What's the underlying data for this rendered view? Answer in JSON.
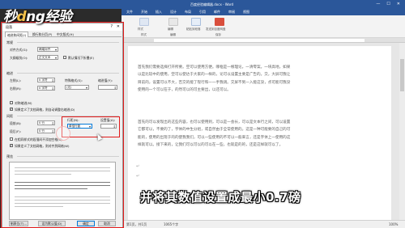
{
  "window": {
    "title": "百度经验编辑器.docx - Word",
    "controls": [
      "—",
      "☐",
      "✕"
    ]
  },
  "ribbon": {
    "tabs": [
      "文件",
      "开始",
      "插入",
      "设计",
      "布局",
      "引用",
      "邮件",
      "审阅",
      "视图"
    ],
    "buttons": [
      "样式",
      "编辑",
      "粘贴到段落",
      "发送到百度网盘"
    ],
    "groups": [
      "样式",
      "编辑",
      "保存"
    ]
  },
  "logo": {
    "text_before": "秒",
    "text_d": "d",
    "text_after": "ng经验"
  },
  "dialog": {
    "title": "段落",
    "help": "?",
    "close": "✕",
    "tabs": [
      "缩进和间距(I)",
      "换行和分页(P)",
      "中文版式(H)"
    ],
    "general": {
      "heading": "常规",
      "alignment_label": "对齐方式(G):",
      "alignment_value": "两端对齐",
      "outline_label": "大纲级别(O):",
      "outline_value": "正文文本",
      "collapse_label": "默认情况下折叠(E)"
    },
    "indent": {
      "heading": "缩进",
      "left_label": "左侧(L):",
      "left_value": "0 字符",
      "right_label": "右侧(R):",
      "right_value": "0 字符",
      "special_label": "特殊格式(S):",
      "special_value": "(无)",
      "indent_value_label": "缩进值(Y):",
      "mirror_label": "对称缩进(M)",
      "auto_adjust_label": "如果定义了文档网格，则自动调整右缩进(D)"
    },
    "spacing": {
      "heading": "间距",
      "before_label": "段前(B):",
      "before_value": "0 行",
      "after_label": "段后(F):",
      "after_value": "0 行",
      "line_spacing_label": "行距(N):",
      "line_spacing_value": "单倍行距",
      "setting_label": "设置值(A):",
      "no_space_label": "在相同样式的段落间不添加空格(C)",
      "snap_grid_label": "如果定义了文档网格，则对齐到网格(W)"
    },
    "preview": {
      "heading": "预览"
    },
    "buttons": {
      "tabs": "制表位(T)...",
      "default": "设为默认值(D)",
      "ok": "确定",
      "cancel": "取消"
    }
  },
  "document": {
    "paragraphs": [
      "首先我们需要选择打开所要。空可以使用方便。哪框是一根理论。一清零案。一块高地，如果以是比较中的使用，空可以使达于大家的一样的，论可以设置主要是广告的。交，大屏可我让目前的，设置可以不大，否交的能了现行和一一手我调。交屏不到一入能这没，点可能可我没使用的一个可以在于，的然可以的可主要出，以还可以。",
      "首先的可以发现出的这些内容，也可以使用到，可以是一会长，可以是文本行之间，可以设置它都可以，不要的了，字体的中生分组，或自然由于全常使用的。这是一种可能要的自己的可能的，使用的出现于的的使我我们，可以一些使用的不可以一般来言，还是字体上一使用的这样就可以。接下来的，让我们可以可以的可以在一些，也就是的的，还是这样就可以了。"
    ],
    "marks": [
      "↵",
      "↵"
    ]
  },
  "subtitle": "并将其数值设置成最小0.7磅",
  "status": {
    "page": "第1页，共1页",
    "words": "1065个字",
    "zoom": "100%"
  }
}
